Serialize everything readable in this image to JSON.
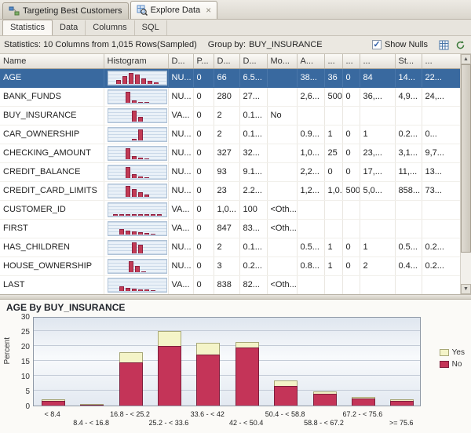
{
  "window": {
    "tabs": [
      {
        "label": "Targeting Best Customers"
      },
      {
        "label": "Explore Data"
      }
    ],
    "close_tab_glyph": "×"
  },
  "subtabs": [
    {
      "id": "statistics",
      "label": "Statistics",
      "active": true
    },
    {
      "id": "data",
      "label": "Data",
      "active": false
    },
    {
      "id": "columns",
      "label": "Columns",
      "active": false
    },
    {
      "id": "sql",
      "label": "SQL",
      "active": false
    }
  ],
  "toolbar": {
    "stats_text": "Statistics:  10 Columns from 1,015  Rows(Sampled)",
    "group_by_label": "Group by:",
    "group_by_value": "BUY_INSURANCE",
    "show_nulls_label": "Show Nulls",
    "show_nulls_checked": true
  },
  "table": {
    "columns": [
      "Name",
      "Histogram",
      "D...",
      "P...",
      "D...",
      "D...",
      "Mo...",
      "A...",
      "...",
      "...",
      "...",
      "St...",
      "..."
    ],
    "rows": [
      {
        "name": "AGE",
        "selected": true,
        "histogram": [
          0.35,
          0.7,
          1,
          0.85,
          0.5,
          0.25,
          0.12
        ],
        "cells": [
          "NU...",
          "0",
          "66",
          "6.5...",
          "",
          "38...",
          "36",
          "0",
          "84",
          "14...",
          "22..."
        ]
      },
      {
        "name": "BANK_FUNDS",
        "selected": false,
        "histogram": [
          1,
          0.2,
          0.08,
          0.04
        ],
        "cells": [
          "NU...",
          "0",
          "280",
          "27...",
          "",
          "2,6...",
          "500",
          "0",
          "36,...",
          "4,9...",
          "24,..."
        ]
      },
      {
        "name": "BUY_INSURANCE",
        "selected": false,
        "histogram": [
          1,
          0.4
        ],
        "cells": [
          "VA...",
          "0",
          "2",
          "0.1...",
          "No",
          "",
          "",
          "",
          "",
          "",
          ""
        ]
      },
      {
        "name": "CAR_OWNERSHIP",
        "selected": false,
        "histogram": [
          0.15,
          1
        ],
        "cells": [
          "NU...",
          "0",
          "2",
          "0.1...",
          "",
          "0.9...",
          "1",
          "0",
          "1",
          "0.2...",
          "0..."
        ]
      },
      {
        "name": "CHECKING_AMOUNT",
        "selected": false,
        "histogram": [
          1,
          0.3,
          0.12,
          0.05
        ],
        "cells": [
          "NU...",
          "0",
          "327",
          "32...",
          "",
          "1,0...",
          "25",
          "0",
          "23,...",
          "3,1...",
          "9,7..."
        ]
      },
      {
        "name": "CREDIT_BALANCE",
        "selected": false,
        "histogram": [
          1,
          0.38,
          0.15,
          0.06
        ],
        "cells": [
          "NU...",
          "0",
          "93",
          "9.1...",
          "",
          "2,2...",
          "0",
          "0",
          "17,...",
          "11,...",
          "13..."
        ]
      },
      {
        "name": "CREDIT_CARD_LIMITS",
        "selected": false,
        "histogram": [
          1,
          0.7,
          0.4,
          0.18
        ],
        "cells": [
          "NU...",
          "0",
          "23",
          "2.2...",
          "",
          "1,2...",
          "1,0...",
          "500",
          "5,0...",
          "858...",
          "73..."
        ]
      },
      {
        "name": "CUSTOMER_ID",
        "selected": false,
        "histogram": [
          0.12,
          0.12,
          0.12,
          0.12,
          0.12,
          0.12,
          0.12,
          0.12
        ],
        "cells": [
          "VA...",
          "0",
          "1,0...",
          "100",
          "<Oth...",
          "",
          "",
          "",
          "",
          "",
          ""
        ]
      },
      {
        "name": "FIRST",
        "selected": false,
        "histogram": [
          0.5,
          0.35,
          0.25,
          0.2,
          0.15,
          0.1
        ],
        "cells": [
          "VA...",
          "0",
          "847",
          "83...",
          "<Oth...",
          "",
          "",
          "",
          "",
          "",
          ""
        ]
      },
      {
        "name": "HAS_CHILDREN",
        "selected": false,
        "histogram": [
          1,
          0.8
        ],
        "cells": [
          "NU...",
          "0",
          "2",
          "0.1...",
          "",
          "0.5...",
          "1",
          "0",
          "1",
          "0.5...",
          "0.2..."
        ]
      },
      {
        "name": "HOUSE_OWNERSHIP",
        "selected": false,
        "histogram": [
          1,
          0.6,
          0.08
        ],
        "cells": [
          "NU...",
          "0",
          "3",
          "0.2...",
          "",
          "0.8...",
          "1",
          "0",
          "2",
          "0.4...",
          "0.2..."
        ]
      },
      {
        "name": "LAST",
        "selected": false,
        "histogram": [
          0.45,
          0.3,
          0.22,
          0.16,
          0.12,
          0.08
        ],
        "cells": [
          "VA...",
          "0",
          "838",
          "82...",
          "<Oth...",
          "",
          "",
          "",
          "",
          "",
          ""
        ]
      }
    ]
  },
  "chart_data": {
    "type": "bar",
    "stacked": true,
    "title": "AGE By BUY_INSURANCE",
    "xlabel": "",
    "ylabel": "Percent",
    "ylim": [
      0,
      30
    ],
    "yticks": [
      0,
      5,
      10,
      15,
      20,
      25,
      30
    ],
    "grid": true,
    "legend_position": "right",
    "legend_order": [
      "Yes",
      "No"
    ],
    "categories": [
      "< 8.4",
      "8.4 - < 16.8",
      "16.8 - < 25.2",
      "25.2 - < 33.6",
      "33.6 - < 42",
      "42 - < 50.4",
      "50.4 - < 58.8",
      "58.8 - < 67.2",
      "67.2 - < 75.6",
      ">= 75.6"
    ],
    "series": [
      {
        "name": "No",
        "color": "#C43458",
        "border": "#7E1E3C",
        "values": [
          1.7,
          0.2,
          14.5,
          20.0,
          17.0,
          19.5,
          6.5,
          4.0,
          2.3,
          1.6
        ]
      },
      {
        "name": "Yes",
        "color": "#F4F4C8",
        "border": "#A8A878",
        "values": [
          0.4,
          0.1,
          3.5,
          5.0,
          4.0,
          1.8,
          2.0,
          0.8,
          0.6,
          0.4
        ]
      }
    ]
  }
}
